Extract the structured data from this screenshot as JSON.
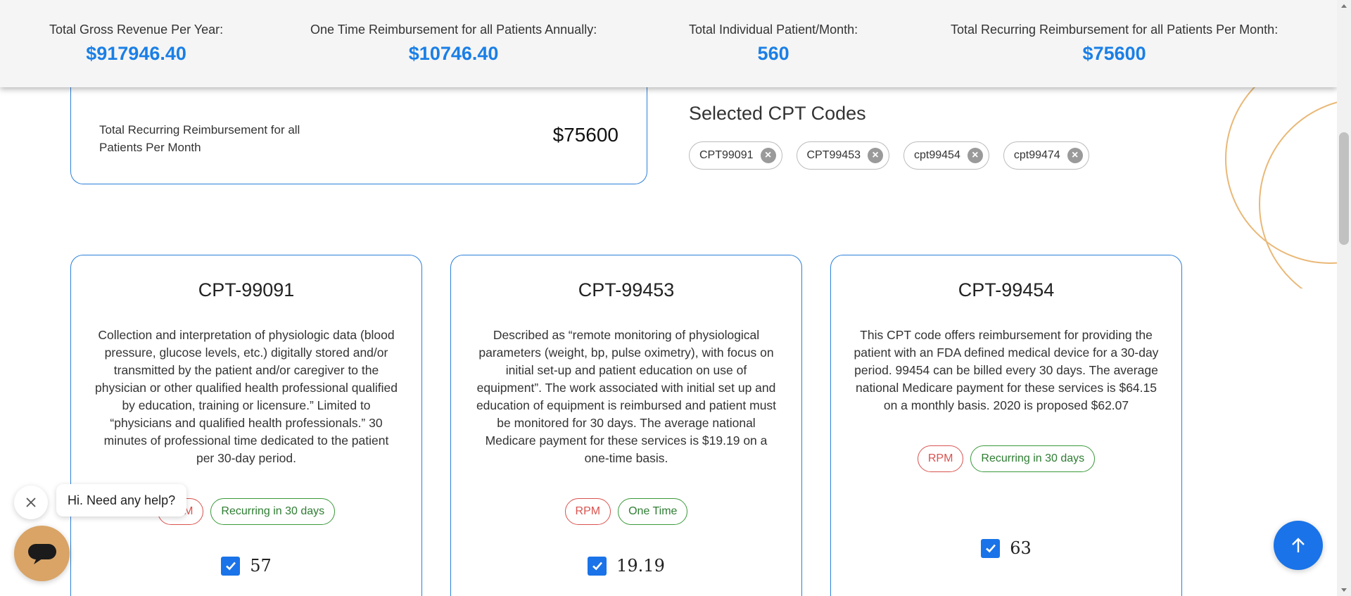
{
  "summary": {
    "stats": [
      {
        "label": "Total Gross Revenue Per Year:",
        "value": "$917946.40"
      },
      {
        "label": "One Time Reimbursement for all Patients Annually:",
        "value": "$10746.40"
      },
      {
        "label": "Total Individual Patient/Month:",
        "value": "560"
      },
      {
        "label": "Total Recurring Reimbursement for all Patients Per Month:",
        "value": "$75600"
      }
    ]
  },
  "total_box": {
    "label": "Total Recurring Reimbursement for all Patients Per Month",
    "value": "$75600"
  },
  "selected": {
    "title": "Selected CPT Codes",
    "chips": [
      "CPT99091",
      "CPT99453",
      "cpt99454",
      "cpt99474"
    ]
  },
  "cards": [
    {
      "title": "CPT-99091",
      "description": "Collection and interpretation of physiologic data (blood pressure, glucose levels, etc.) digitally stored and/or transmitted by the patient and/or caregiver to the physician or other qualified health professional qualified by education, training or licensure.” Limited to “physicians and qualified health professionals.” 30 minutes of professional time dedicated to the patient per 30-day period.",
      "tags": [
        "RPM",
        "Recurring in 30 days"
      ],
      "checked": true,
      "value": "57"
    },
    {
      "title": "CPT-99453",
      "description": "Described as “remote monitoring of physiological parameters (weight, bp, pulse oximetry), with focus on initial set-up and patient education on use of equipment”. The work associated with initial set up and education of equipment is reimbursed and patient must be monitored for 30 days. The average national Medicare payment for these services is $19.19 on a one-time basis.",
      "tags": [
        "RPM",
        "One Time"
      ],
      "checked": true,
      "value": "19.19"
    },
    {
      "title": "CPT-99454",
      "description": "This CPT code offers reimbursement for providing the patient with an FDA defined medical device for a 30-day period. 99454 can be billed every 30 days. The average national Medicare payment for these services is $64.15 on a monthly basis. 2020 is proposed $62.07",
      "tags": [
        "RPM",
        "Recurring in 30 days"
      ],
      "checked": true,
      "value": "63"
    }
  ],
  "chat": {
    "greeting": "Hi. Need any help?"
  },
  "colors": {
    "accent": "#1a7fe6",
    "card_border": "#2b7fd8",
    "rpm_tag": "#d9534f",
    "recurring_tag": "#2e7d32",
    "chat_launcher": "#d9a466"
  },
  "icons": {
    "chip_remove": "close-circle-icon",
    "checkbox": "check-icon",
    "chat_close": "close-icon",
    "chat_launcher": "chat-bubble-icon",
    "to_top": "arrow-up-icon"
  }
}
